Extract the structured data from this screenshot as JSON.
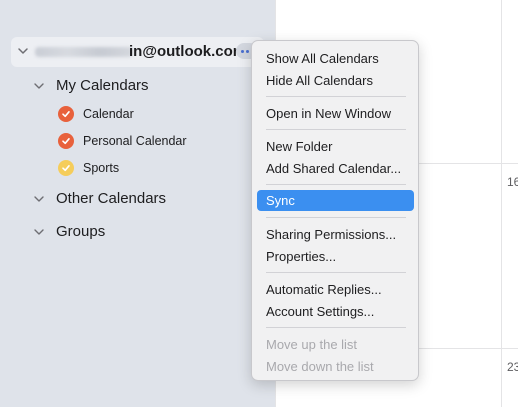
{
  "sidebar": {
    "account": {
      "email": "in@outlook.com"
    },
    "groups": [
      {
        "label": "My Calendars"
      },
      {
        "label": "Other Calendars"
      },
      {
        "label": "Groups"
      }
    ],
    "calendars": [
      {
        "label": "Calendar",
        "color": "#e8613c"
      },
      {
        "label": "Personal Calendar",
        "color": "#e8613c"
      },
      {
        "label": "Sports",
        "color": "#f5cd5b"
      }
    ]
  },
  "calendar_grid": {
    "day_numbers": [
      "16",
      "23"
    ]
  },
  "context_menu": {
    "items": [
      {
        "label": "Show All Calendars",
        "state": "enabled"
      },
      {
        "label": "Hide All Calendars",
        "state": "enabled"
      },
      {
        "label": "Open in New Window",
        "state": "enabled"
      },
      {
        "label": "New Folder",
        "state": "enabled"
      },
      {
        "label": "Add Shared Calendar...",
        "state": "enabled"
      },
      {
        "label": "Sync",
        "state": "highlighted"
      },
      {
        "label": "Sharing Permissions...",
        "state": "enabled"
      },
      {
        "label": "Properties...",
        "state": "enabled"
      },
      {
        "label": "Automatic Replies...",
        "state": "enabled"
      },
      {
        "label": "Account Settings...",
        "state": "enabled"
      },
      {
        "label": "Move up the list",
        "state": "disabled"
      },
      {
        "label": "Move down the list",
        "state": "disabled"
      }
    ]
  },
  "colors": {
    "sidebar_bg": "#dfe3ea",
    "menu_highlight": "#3b8ff0",
    "check_red": "#e8613c",
    "check_yellow": "#f5cd5b"
  }
}
